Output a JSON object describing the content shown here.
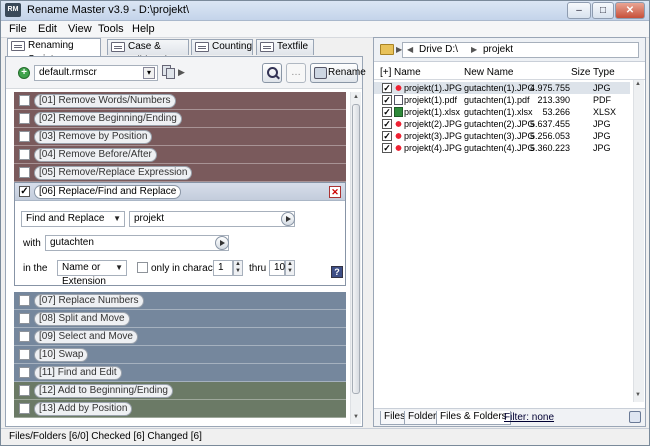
{
  "window": {
    "title": "Rename Master v3.9 - D:\\projekt\\",
    "icon": "RM"
  },
  "menu": [
    "File",
    "Edit",
    "View",
    "Tools",
    "Help"
  ],
  "tabs": [
    {
      "label": "Renaming Script",
      "active": true
    },
    {
      "label": "Case & Wildcards",
      "active": false
    },
    {
      "label": "Counting",
      "active": false
    },
    {
      "label": "Textfile",
      "active": false
    }
  ],
  "toolbar": {
    "script_name": "default.rmscr",
    "rename_label": "Rename"
  },
  "script_items": [
    {
      "label": "[01] Remove Words/Numbers",
      "color": "#7a5a5c"
    },
    {
      "label": "[02] Remove Beginning/Ending",
      "color": "#7a5a5c"
    },
    {
      "label": "[03] Remove by Position",
      "color": "#7a5a5c"
    },
    {
      "label": "[04] Remove Before/After",
      "color": "#7a5a5c"
    },
    {
      "label": "[05] Remove/Replace Expression",
      "color": "#7a5a5c"
    },
    {
      "label": "[07] Replace Numbers",
      "color": "#75879d"
    },
    {
      "label": "[08] Split and Move",
      "color": "#75879d"
    },
    {
      "label": "[09] Select and Move",
      "color": "#75879d"
    },
    {
      "label": "[10] Swap",
      "color": "#75879d"
    },
    {
      "label": "[11] Find and Edit",
      "color": "#75879d"
    },
    {
      "label": "[12] Add to Beginning/Ending",
      "color": "#6b7a66"
    },
    {
      "label": "[13] Add by Position",
      "color": "#6b7a66"
    }
  ],
  "expanded": {
    "label": "[06] Replace/Find and Replace",
    "checked_mark": "✓",
    "mode": "Find and Replace",
    "find_value": "projekt",
    "with_label": "with",
    "with_value": "gutachten",
    "in_the_label": "in the",
    "scope": "Name or Extension",
    "only_chars_label": "only in characters",
    "from_value": "1",
    "thru_label": "thru",
    "to_value": "10",
    "help_label": "?"
  },
  "right": {
    "toggle_label": "[+]",
    "path_drive": "Drive D:\\",
    "path_folder": "projekt",
    "columns": {
      "name": "Name",
      "new_name": "New Name",
      "size": "Size",
      "type": "Type"
    },
    "files": [
      {
        "name": "projekt(1).JPG",
        "new_name": "gutachten(1).JPG",
        "size": "4.975.755",
        "type": "JPG",
        "icon": "jpg"
      },
      {
        "name": "projekt(1).pdf",
        "new_name": "gutachten(1).pdf",
        "size": "213.390",
        "type": "PDF",
        "icon": "pdf"
      },
      {
        "name": "projekt(1).xlsx",
        "new_name": "gutachten(1).xlsx",
        "size": "53.266",
        "type": "XLSX",
        "icon": "xlsx"
      },
      {
        "name": "projekt(2).JPG",
        "new_name": "gutachten(2).JPG",
        "size": "5.637.455",
        "type": "JPG",
        "icon": "jpg"
      },
      {
        "name": "projekt(3).JPG",
        "new_name": "gutachten(3).JPG",
        "size": "5.256.053",
        "type": "JPG",
        "icon": "jpg"
      },
      {
        "name": "projekt(4).JPG",
        "new_name": "gutachten(4).JPG",
        "size": "5.360.223",
        "type": "JPG",
        "icon": "jpg"
      }
    ],
    "bottom_tabs": [
      "Files",
      "Folders",
      "Files & Folders"
    ],
    "filter": "Filter:  none"
  },
  "status": "Files/Folders [6/0] Checked [6] Changed [6]"
}
